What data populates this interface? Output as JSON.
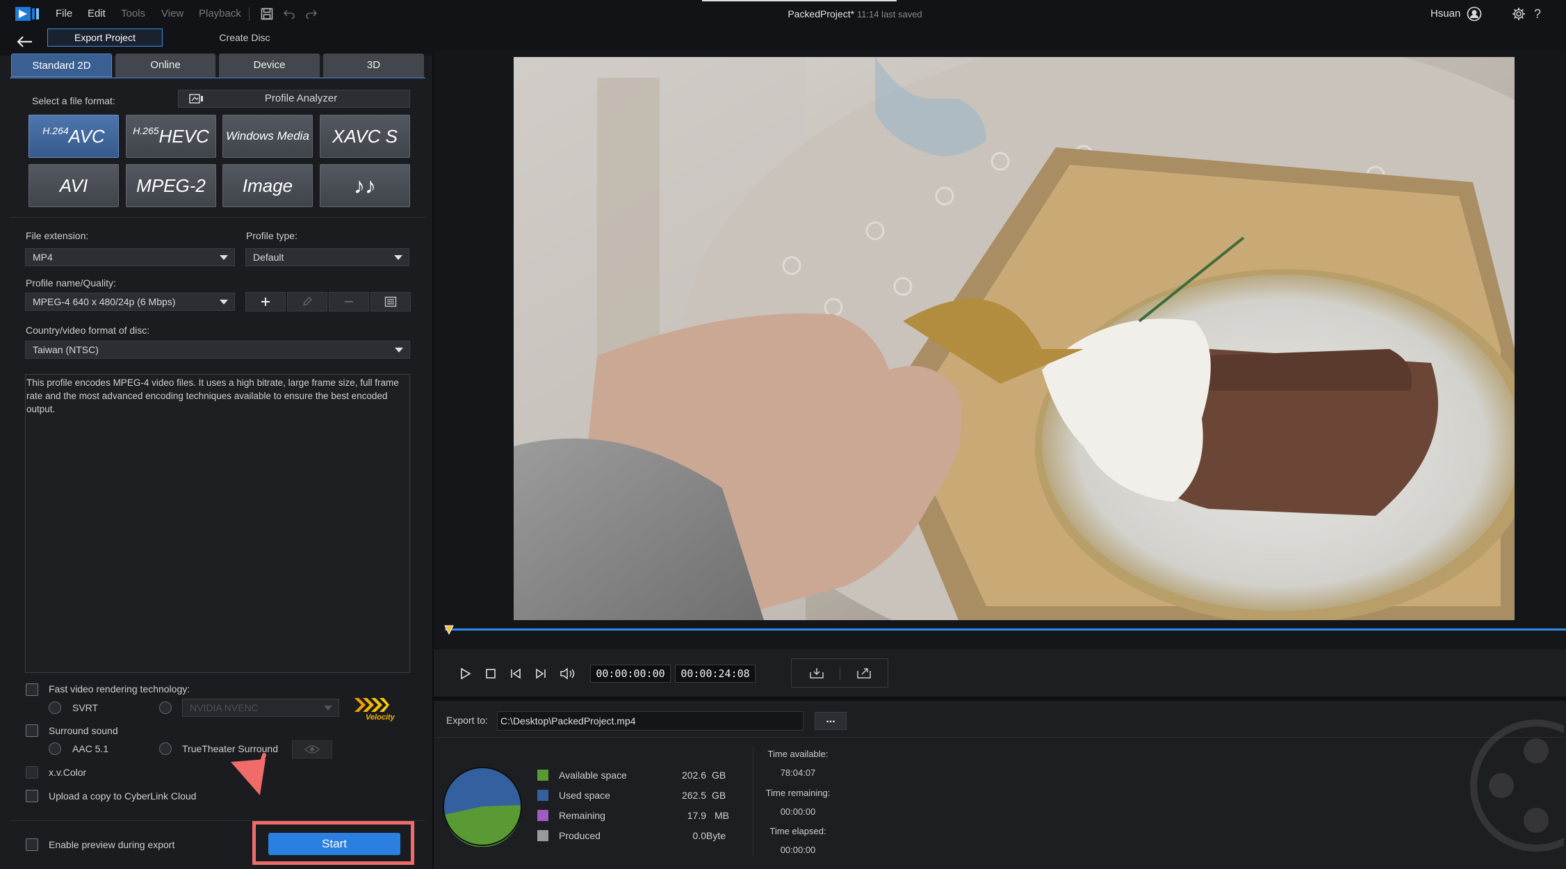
{
  "app": {
    "title": "PackedProject*",
    "saved_status": "11:14 last saved",
    "user": "Hsuan",
    "help": "?"
  },
  "menu": {
    "file": "File",
    "edit": "Edit",
    "tools": "Tools",
    "view": "View",
    "playback": "Playback"
  },
  "subnav": {
    "export_project": "Export Project",
    "create_disc": "Create Disc"
  },
  "tabs": [
    "Standard 2D",
    "Online",
    "Device",
    "3D"
  ],
  "format": {
    "select_label": "Select a file format:",
    "profile_analyzer": "Profile Analyzer",
    "buttons": [
      {
        "sup": "H.264",
        "label": "AVC"
      },
      {
        "sup": "H.265",
        "label": "HEVC"
      },
      {
        "sup": "",
        "label": "Windows Media"
      },
      {
        "sup": "",
        "label": "XAVC S"
      },
      {
        "sup": "",
        "label": "AVI"
      },
      {
        "sup": "",
        "label": "MPEG-2"
      },
      {
        "sup": "",
        "label": "Image"
      },
      {
        "sup": "",
        "label": "♪♪"
      }
    ]
  },
  "settings": {
    "file_extension_label": "File extension:",
    "file_extension_value": "MP4",
    "profile_type_label": "Profile type:",
    "profile_type_value": "Default",
    "profile_name_label": "Profile name/Quality:",
    "profile_name_value": "MPEG-4 640 x 480/24p (6 Mbps)",
    "country_label": "Country/video format of disc:",
    "country_value": "Taiwan (NTSC)",
    "description": "This profile encodes MPEG-4 video files. It uses a high bitrate, large frame size, full frame rate and the most advanced encoding techniques available to ensure the best encoded output."
  },
  "options": {
    "fast_render": "Fast video rendering technology:",
    "svrt": "SVRT",
    "nvenc": "NVIDIA NVENC",
    "velocity": "Velocity",
    "surround": "Surround sound",
    "aac": "AAC 5.1",
    "truetheater": "TrueTheater Surround",
    "xvcolor": "x.v.Color",
    "upload": "Upload a copy to CyberLink Cloud",
    "enable_preview": "Enable preview during export",
    "start": "Start"
  },
  "player": {
    "current_time": "00:00:00:00",
    "duration": "00:00:24:08"
  },
  "export": {
    "export_to_label": "Export to:",
    "export_path": "C:\\Desktop\\PackedProject.mp4",
    "browse": "...",
    "legend": [
      {
        "label": "Available space",
        "value": "202.6",
        "unit": "GB",
        "color": "#5a9a35"
      },
      {
        "label": "Used space",
        "value": "262.5",
        "unit": "GB",
        "color": "#3560a0"
      },
      {
        "label": "Remaining",
        "value": "17.9",
        "unit": "MB",
        "color": "#a05cc0"
      },
      {
        "label": "Produced",
        "value": "0.0",
        "unit": "Byte",
        "color": "#9a9a9a"
      }
    ],
    "time_available_label": "Time available:",
    "time_available": "78:04:07",
    "time_remaining_label": "Time remaining:",
    "time_remaining": "00:00:00",
    "time_elapsed_label": "Time elapsed:",
    "time_elapsed": "00:00:00"
  },
  "colors": {
    "accent": "#2a7fe0",
    "highlight": "#f26b6b",
    "tab_active": "#3a5f93"
  }
}
